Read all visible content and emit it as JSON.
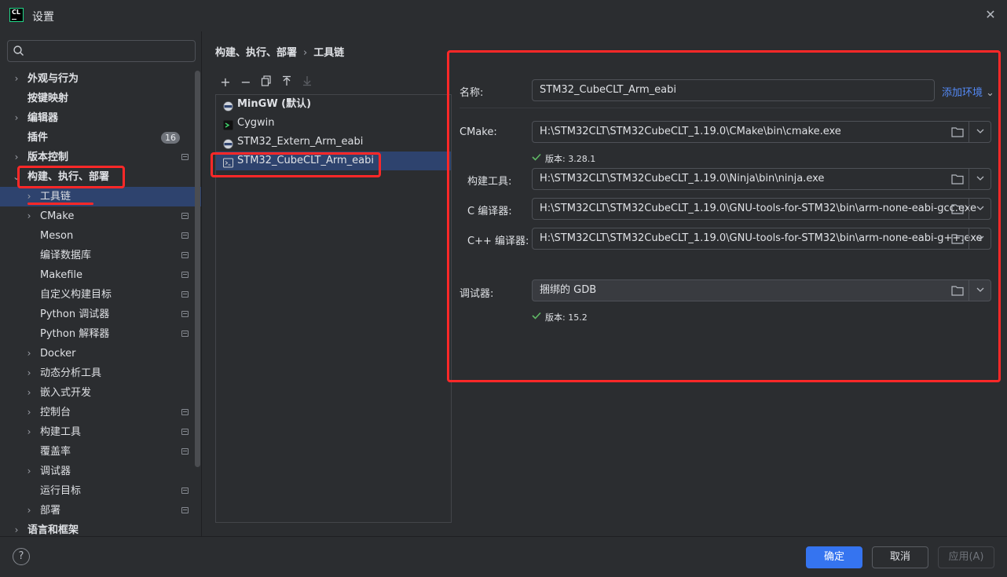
{
  "window": {
    "title": "设置",
    "logo_text": "CL"
  },
  "search": {
    "placeholder": "",
    "value": ""
  },
  "sidebar": {
    "items": [
      {
        "label": "外观与行为",
        "bold": true,
        "chevron": true,
        "level": 0
      },
      {
        "label": "按键映射",
        "bold": true,
        "chevron": false,
        "level": 0
      },
      {
        "label": "编辑器",
        "bold": true,
        "chevron": true,
        "level": 0
      },
      {
        "label": "插件",
        "bold": true,
        "chevron": false,
        "level": 0,
        "badge": "16"
      },
      {
        "label": "版本控制",
        "bold": true,
        "chevron": true,
        "level": 0,
        "square": true
      },
      {
        "label": "构建、执行、部署",
        "bold": true,
        "chevron": true,
        "expanded": true,
        "level": 0
      },
      {
        "label": "工具链",
        "bold": false,
        "chevron": true,
        "level": 1,
        "selected": true
      },
      {
        "label": "CMake",
        "bold": false,
        "chevron": true,
        "level": 1,
        "square": true
      },
      {
        "label": "Meson",
        "bold": false,
        "chevron": false,
        "level": 1,
        "square": true
      },
      {
        "label": "编译数据库",
        "bold": false,
        "chevron": false,
        "level": 1,
        "square": true
      },
      {
        "label": "Makefile",
        "bold": false,
        "chevron": false,
        "level": 1,
        "square": true
      },
      {
        "label": "自定义构建目标",
        "bold": false,
        "chevron": false,
        "level": 1,
        "square": true
      },
      {
        "label": "Python 调试器",
        "bold": false,
        "chevron": false,
        "level": 1,
        "square": true
      },
      {
        "label": "Python 解释器",
        "bold": false,
        "chevron": false,
        "level": 1,
        "square": true
      },
      {
        "label": "Docker",
        "bold": false,
        "chevron": true,
        "level": 1
      },
      {
        "label": "动态分析工具",
        "bold": false,
        "chevron": true,
        "level": 1
      },
      {
        "label": "嵌入式开发",
        "bold": false,
        "chevron": true,
        "level": 1
      },
      {
        "label": "控制台",
        "bold": false,
        "chevron": true,
        "level": 1,
        "square": true
      },
      {
        "label": "构建工具",
        "bold": false,
        "chevron": true,
        "level": 1,
        "square": true
      },
      {
        "label": "覆盖率",
        "bold": false,
        "chevron": false,
        "level": 1,
        "square": true
      },
      {
        "label": "调试器",
        "bold": false,
        "chevron": true,
        "level": 1
      },
      {
        "label": "运行目标",
        "bold": false,
        "chevron": false,
        "level": 1,
        "square": true
      },
      {
        "label": "部署",
        "bold": false,
        "chevron": true,
        "level": 1,
        "square": true
      },
      {
        "label": "语言和框架",
        "bold": true,
        "chevron": true,
        "level": 0
      }
    ]
  },
  "breadcrumb": {
    "parent": "构建、执行、部署",
    "separator": "›",
    "current": "工具链"
  },
  "toolchains": {
    "items": [
      {
        "label": "MinGW (默认)",
        "bold": true,
        "icon": "gnu-icon"
      },
      {
        "label": "Cygwin",
        "bold": false,
        "icon": "cygwin-icon"
      },
      {
        "label": "STM32_Extern_Arm_eabi",
        "bold": false,
        "icon": "gnu-icon"
      },
      {
        "label": "STM32_CubeCLT_Arm_eabi",
        "bold": false,
        "icon": "terminal-icon",
        "selected": true
      }
    ]
  },
  "form": {
    "name_label": "名称:",
    "name_value": "STM32_CubeCLT_Arm_eabi",
    "add_env_label": "添加环境",
    "cmake_label": "CMake:",
    "cmake_value": "H:\\STM32CLT\\STM32CubeCLT_1.19.0\\CMake\\bin\\cmake.exe",
    "cmake_version": "版本: 3.28.1",
    "build_tool_label": "构建工具:",
    "build_tool_value": "H:\\STM32CLT\\STM32CubeCLT_1.19.0\\Ninja\\bin\\ninja.exe",
    "c_compiler_label": "C 编译器:",
    "c_compiler_value": "H:\\STM32CLT\\STM32CubeCLT_1.19.0\\GNU-tools-for-STM32\\bin\\arm-none-eabi-gcc.exe",
    "cpp_compiler_label": "C++ 编译器:",
    "cpp_compiler_value": "H:\\STM32CLT\\STM32CubeCLT_1.19.0\\GNU-tools-for-STM32\\bin\\arm-none-eabi-g++.exe",
    "debugger_label": "调试器:",
    "debugger_value": "捆绑的 GDB",
    "debugger_version": "版本: 15.2"
  },
  "footer": {
    "ok_label": "确定",
    "cancel_label": "取消",
    "apply_label": "应用(A)",
    "help_label": "?"
  },
  "colors": {
    "accent": "#3574f0",
    "selection": "#2e436e",
    "highlight": "#ff2828",
    "link": "#548af7",
    "check": "#5fb865"
  }
}
